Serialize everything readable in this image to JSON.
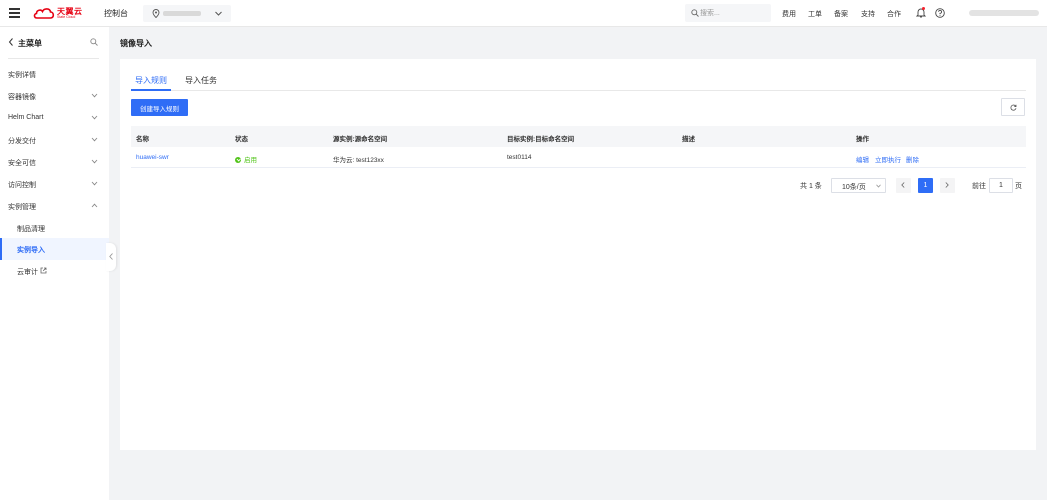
{
  "topbar": {
    "logo_cn": "天翼云",
    "logo_en": "State Cloud",
    "console": "控制台",
    "search_placeholder": "搜索...",
    "links": [
      "费用",
      "工单",
      "备案",
      "支持",
      "合作"
    ]
  },
  "sidebar": {
    "title": "主菜单",
    "items": [
      {
        "label": "实例详情"
      },
      {
        "label": "容器镜像"
      },
      {
        "label": "Helm Chart"
      },
      {
        "label": "分发交付"
      },
      {
        "label": "安全可信"
      },
      {
        "label": "访问控制"
      },
      {
        "label": "实例管理"
      },
      {
        "label": "制品清理"
      },
      {
        "label": "实例导入"
      },
      {
        "label": "云审计"
      }
    ]
  },
  "main": {
    "title": "镜像导入",
    "tabs": [
      "导入规则",
      "导入任务"
    ],
    "create_button": "创建导入规则",
    "table": {
      "headers": [
        "名称",
        "状态",
        "源实例:源命名空间",
        "目标实例:目标命名空间",
        "描述",
        "操作"
      ],
      "rows": [
        {
          "name": "huawei-swr",
          "status": "启用",
          "source": "华为云: test123xx",
          "target": "test0114",
          "description": "",
          "ops": [
            "编辑",
            "立即执行",
            "删除"
          ]
        }
      ]
    },
    "pagination": {
      "total": "共 1 条",
      "page_size": "10条/页",
      "current": "1",
      "goto_label": "前往",
      "goto_value": "1",
      "page_unit": "页"
    }
  },
  "colors": {
    "accent": "#2f6df6",
    "success": "#52c41a",
    "brand": "#e60012"
  }
}
